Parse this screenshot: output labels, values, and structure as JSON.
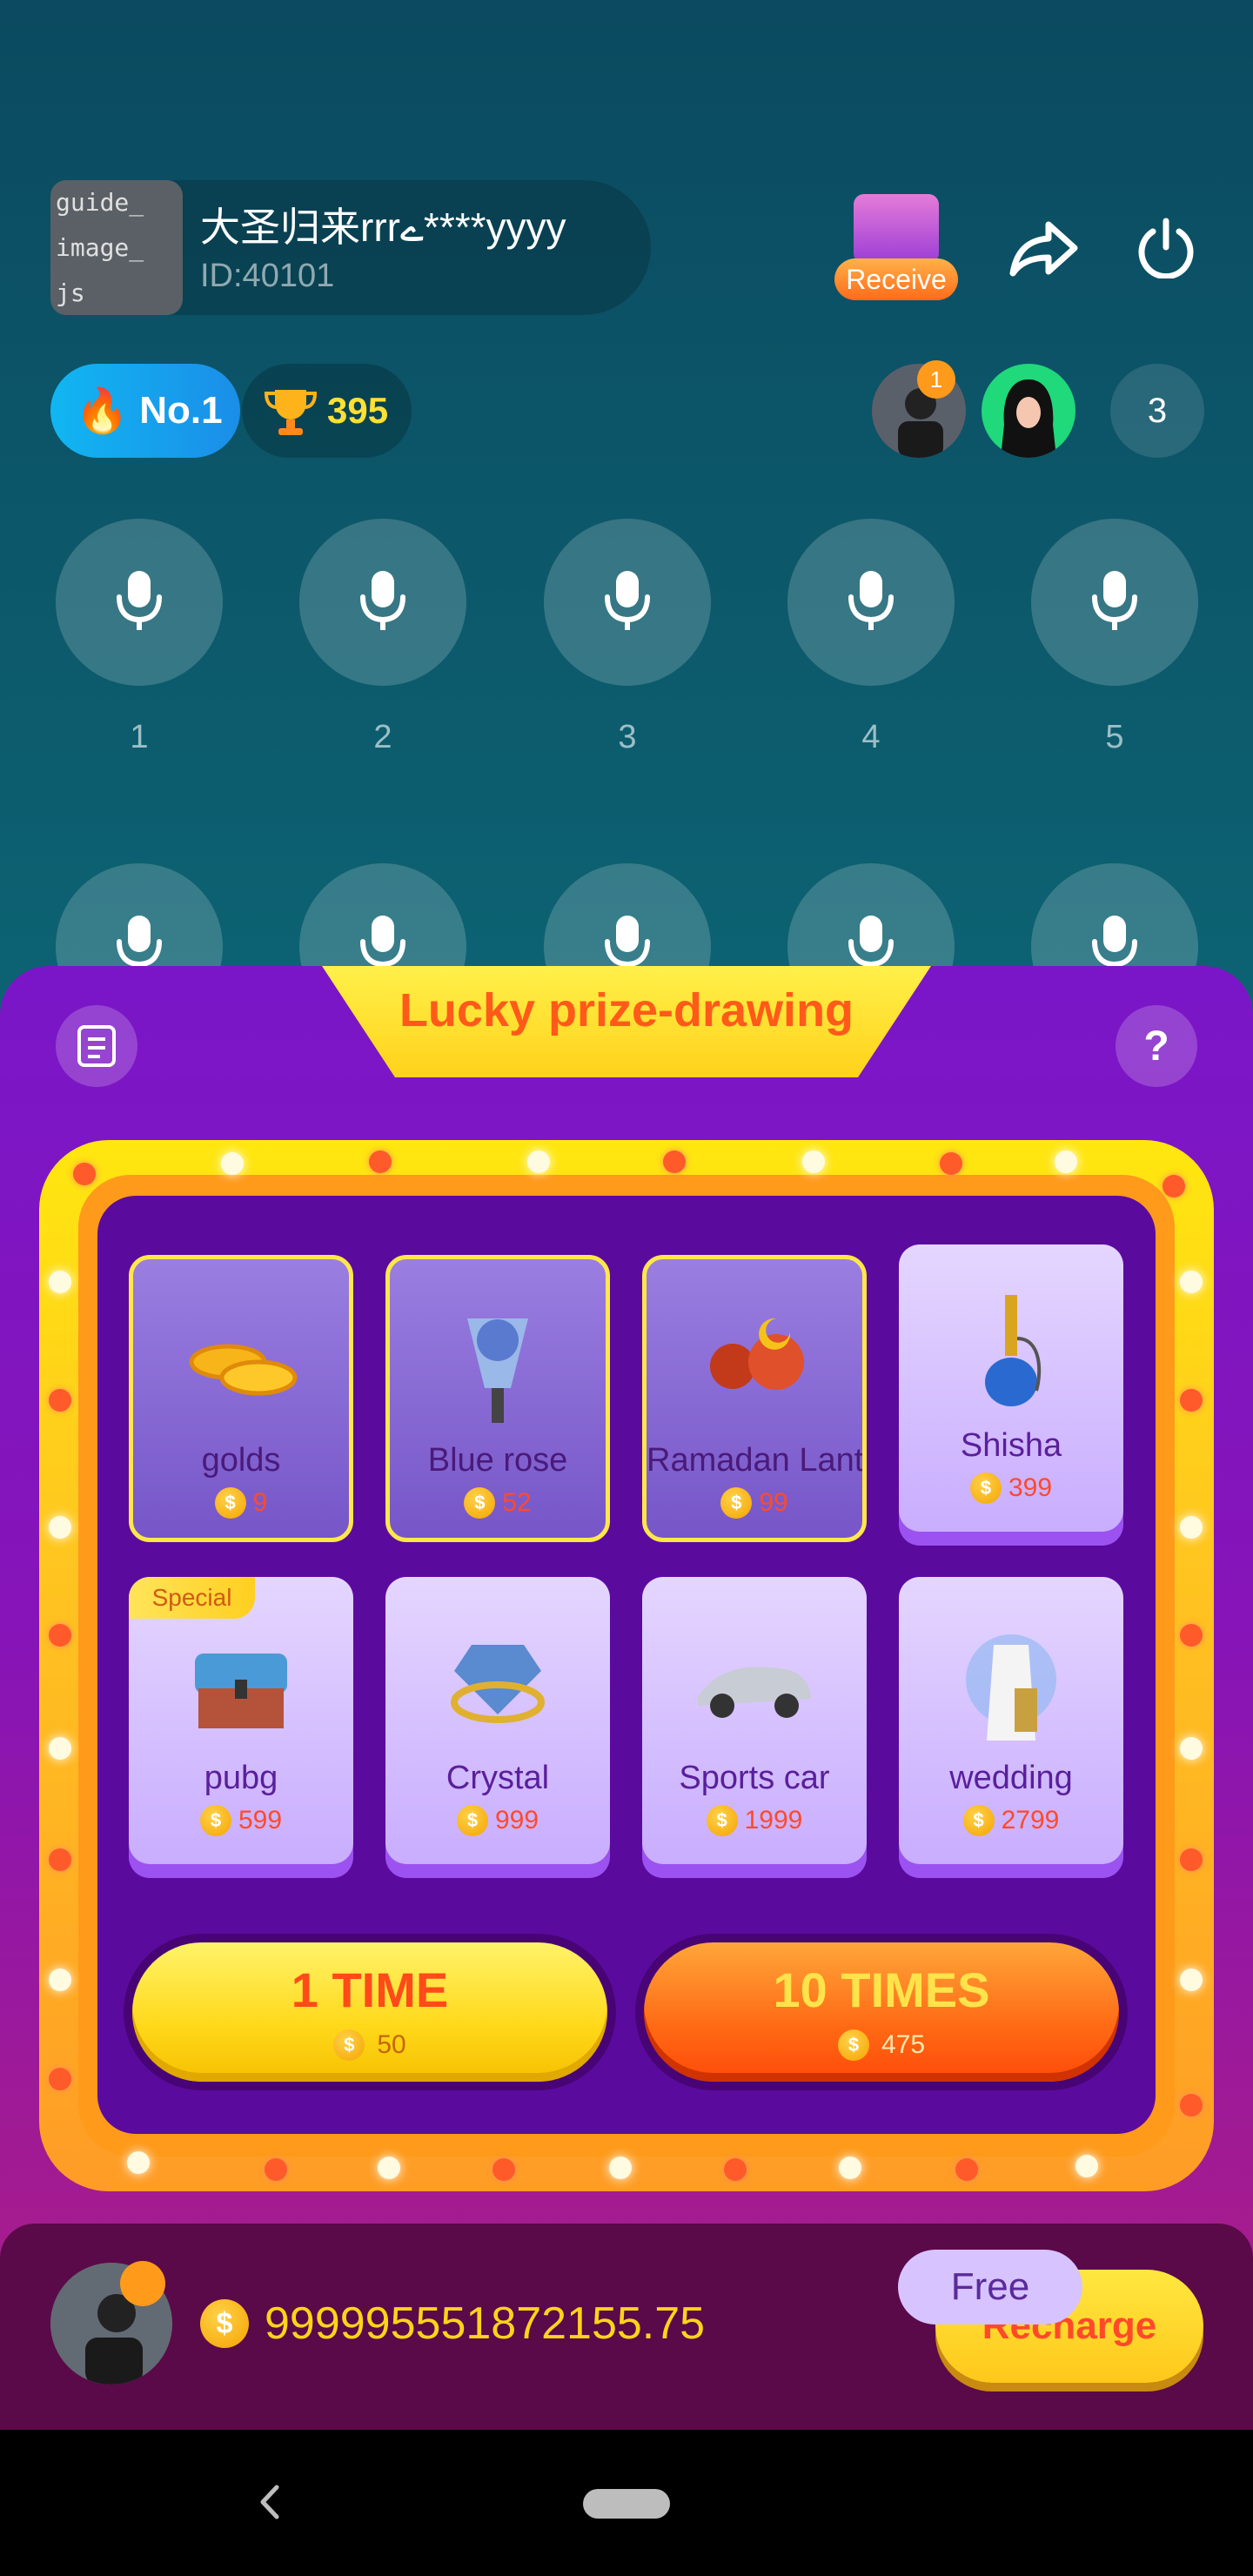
{
  "room": {
    "thumb_lines": [
      "guide_",
      "image_",
      "js"
    ],
    "name": "大圣归来rrrے****yyyy",
    "id_text": "ID:40101"
  },
  "header_actions": {
    "receive_label": "Receive",
    "share_icon": "share-icon",
    "power_icon": "power-icon"
  },
  "badges": {
    "rank_label": "No.1",
    "trophy_count": "395"
  },
  "audience": {
    "top_rank": "1",
    "count": "3"
  },
  "seats": [
    "1",
    "2",
    "3",
    "4",
    "5"
  ],
  "panel": {
    "title": "Lucky prize-drawing",
    "help_label": "?"
  },
  "prizes": [
    {
      "name": "golds",
      "price": "9",
      "state": "selected"
    },
    {
      "name": "Blue rose",
      "price": "52",
      "state": "selected"
    },
    {
      "name": "Ramadan Lant...",
      "price": "99",
      "state": "selected"
    },
    {
      "name": "Shisha",
      "price": "399",
      "state": "normal"
    },
    {
      "name": "pubg",
      "price": "599",
      "state": "normal",
      "tag": "Special"
    },
    {
      "name": "Crystal",
      "price": "999",
      "state": "normal"
    },
    {
      "name": "Sports car",
      "price": "1999",
      "state": "normal"
    },
    {
      "name": "wedding",
      "price": "2799",
      "state": "normal"
    }
  ],
  "draw_buttons": [
    {
      "label": "1 TIME",
      "price": "50"
    },
    {
      "label": "10 TIMES",
      "price": "475"
    }
  ],
  "wallet": {
    "coin_symbol": "$",
    "balance": "999995551872155.75",
    "recharge_label": "Recharge",
    "free_label": "Free"
  },
  "colors": {
    "accent_yellow": "#ffd21a",
    "panel_purple": "#7a16c8",
    "price_red": "#ff4a2a"
  }
}
